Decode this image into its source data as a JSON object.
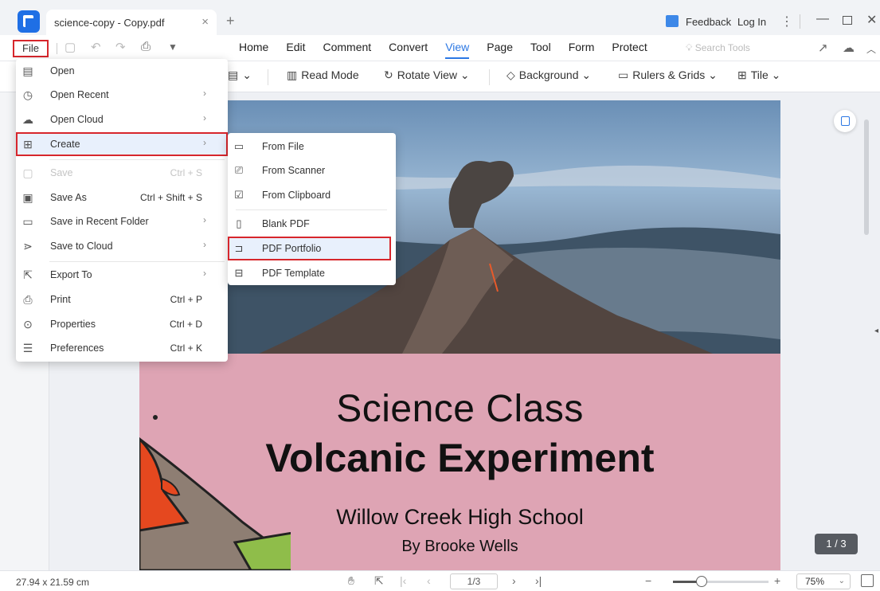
{
  "titlebar": {
    "tab_name": "science-copy - Copy.pdf",
    "tab_close": "×",
    "new_tab": "+",
    "feedback": "Feedback",
    "login": "Log In",
    "kebab": "⋮",
    "minimize": "—",
    "close": "✕"
  },
  "menubar": {
    "file_label": "File",
    "tabs": [
      "Home",
      "Edit",
      "Comment",
      "Convert",
      "View",
      "Page",
      "Tool",
      "Form",
      "Protect"
    ],
    "active_tab": "View",
    "search_tools": "Search Tools"
  },
  "ribbon": {
    "items": [
      {
        "label": "Read Mode",
        "icon": "read-mode-icon"
      },
      {
        "label": "Rotate View",
        "icon": "rotate-icon"
      },
      {
        "label": "Background",
        "icon": "background-icon"
      },
      {
        "label": "Rulers & Grids",
        "icon": "ruler-icon"
      },
      {
        "label": "Tile",
        "icon": "tile-icon"
      }
    ]
  },
  "file_menu": {
    "items": [
      {
        "label": "Open",
        "icon": "open-icon"
      },
      {
        "label": "Open Recent",
        "icon": "clock-icon",
        "submenu": true
      },
      {
        "label": "Open Cloud",
        "icon": "cloud-icon",
        "submenu": true
      },
      {
        "label": "Create",
        "icon": "create-icon",
        "submenu": true
      },
      {
        "label": "Save",
        "shortcut": "Ctrl + S",
        "icon": "save-icon",
        "disabled": true
      },
      {
        "label": "Save As",
        "shortcut": "Ctrl + Shift + S",
        "icon": "save-as-icon"
      },
      {
        "label": "Save in Recent Folder",
        "icon": "folder-icon",
        "submenu": true
      },
      {
        "label": "Save to Cloud",
        "icon": "save-cloud-icon",
        "submenu": true
      },
      {
        "label": "Export To",
        "icon": "export-icon",
        "submenu": true
      },
      {
        "label": "Print",
        "shortcut": "Ctrl + P",
        "icon": "print-icon"
      },
      {
        "label": "Properties",
        "shortcut": "Ctrl + D",
        "icon": "properties-icon"
      },
      {
        "label": "Preferences",
        "shortcut": "Ctrl + K",
        "icon": "preferences-icon"
      }
    ]
  },
  "create_submenu": {
    "items": [
      {
        "label": "From File",
        "icon": "folder-icon"
      },
      {
        "label": "From Scanner",
        "icon": "scanner-icon"
      },
      {
        "label": "From Clipboard",
        "icon": "clipboard-icon"
      },
      {
        "label": "Blank PDF",
        "icon": "blank-page-icon"
      },
      {
        "label": "PDF Portfolio",
        "icon": "portfolio-icon"
      },
      {
        "label": "PDF Template",
        "icon": "template-icon"
      }
    ]
  },
  "document": {
    "title_line1": "Science Class",
    "title_line2": "Volcanic Experiment",
    "school": "Willow Creek High School",
    "author": "By Brooke Wells"
  },
  "page_badge": "1 / 3",
  "statusbar": {
    "dimensions": "27.94 x 21.59 cm",
    "page_input": "1/3",
    "zoom_value": "75%",
    "zoom_fraction": 0.3
  },
  "colors": {
    "accent": "#2c78e4",
    "highlight_box": "#d7262c",
    "page_background": "#dea4b4"
  }
}
